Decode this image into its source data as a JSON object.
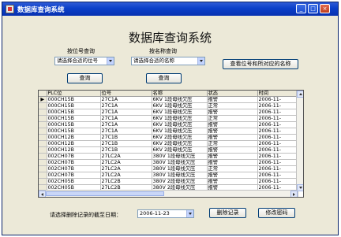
{
  "window": {
    "title": "数据库查询系统",
    "min_glyph": "_",
    "max_glyph": "□",
    "close_glyph": "×"
  },
  "heading": "数据库查询系统",
  "by_position": {
    "label": "按位号查询",
    "combo_value": "请选择合适的位号",
    "button": "查询"
  },
  "by_name": {
    "label": "按名称查询",
    "combo_value": "请选择合适的名称",
    "button": "查询"
  },
  "view_names_button": "查看位号和所对应的名称",
  "grid": {
    "columns": [
      "PLC位",
      "位号",
      "名称",
      "状态",
      "时间"
    ],
    "current_row_marker": "▶",
    "rows": [
      [
        "000CH15B",
        "27C1A",
        "6KV 1段母线欠压",
        "报警",
        "2006-11-"
      ],
      [
        "000CH15B",
        "27C1A",
        "6KV 1段母线欠压",
        "正常",
        "2006-11-"
      ],
      [
        "000CH15B",
        "27C1A",
        "6KV 1段母线欠压",
        "报警",
        "2006-11-"
      ],
      [
        "000CH15B",
        "27C1A",
        "6KV 1段母线欠压",
        "正常",
        "2006-11-"
      ],
      [
        "000CH15B",
        "27C1A",
        "6KV 1段母线欠压",
        "报警",
        "2006-11-"
      ],
      [
        "000CH15B",
        "27C1A",
        "6KV 1段母线欠压",
        "报警",
        "2006-11-"
      ],
      [
        "000CH12B",
        "27C1B",
        "6KV 2段母线欠压",
        "报警",
        "2006-11-"
      ],
      [
        "000CH12B",
        "27C1B",
        "6KV 2段母线欠压",
        "正常",
        "2006-11-"
      ],
      [
        "000CH12B",
        "27C1B",
        "6KV 2段母线欠压",
        "报警",
        "2006-11-"
      ],
      [
        "002CH07B",
        "27LC2A",
        "380V 1段母线欠压",
        "报警",
        "2006-11-"
      ],
      [
        "002CH07B",
        "27LC2A",
        "380V 1段母线欠压",
        "报警",
        "2006-11-"
      ],
      [
        "002CH07B",
        "27LC2A",
        "380V 1段母线欠压",
        "正常",
        "2006-11-"
      ],
      [
        "002CH07B",
        "27LC2A",
        "380V 1段母线欠压",
        "报警",
        "2006-11-"
      ],
      [
        "002CH05B",
        "27LC2B",
        "380V 2段母线欠压",
        "报警",
        "2006-11-"
      ],
      [
        "002CH05B",
        "27LC2B",
        "380V 2段母线欠压",
        "报警",
        "2006-11-"
      ],
      [
        "002CH05B",
        "27LC2B",
        "380V 2段母线欠压",
        "报警",
        "2006-11-"
      ],
      [
        "002CH02B",
        "30Y-1",
        "400V 1段电源故障",
        "报警",
        "2006-11-"
      ]
    ]
  },
  "delete_label": "请选择删除记录的截至日期：",
  "date_value": "2006-11-23",
  "delete_button": "删除记录",
  "change_password_button": "修改密码"
}
